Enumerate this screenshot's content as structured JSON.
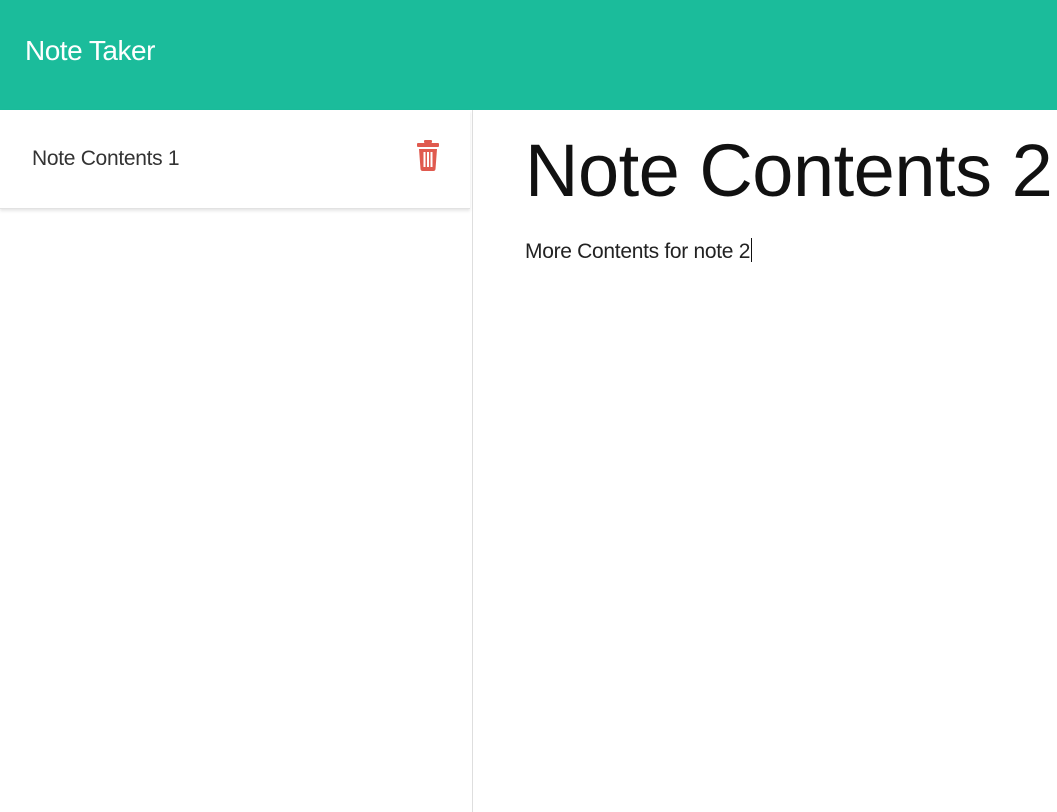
{
  "navbar": {
    "brand": "Note Taker",
    "bg_color": "#1bbc9b"
  },
  "sidebar": {
    "notes": [
      {
        "title": "Note Contents 1",
        "delete_icon": "trash-icon",
        "delete_icon_color": "#e05a4f"
      }
    ]
  },
  "editor": {
    "title": "Note Contents 2",
    "body": "More Contents for note 2"
  }
}
